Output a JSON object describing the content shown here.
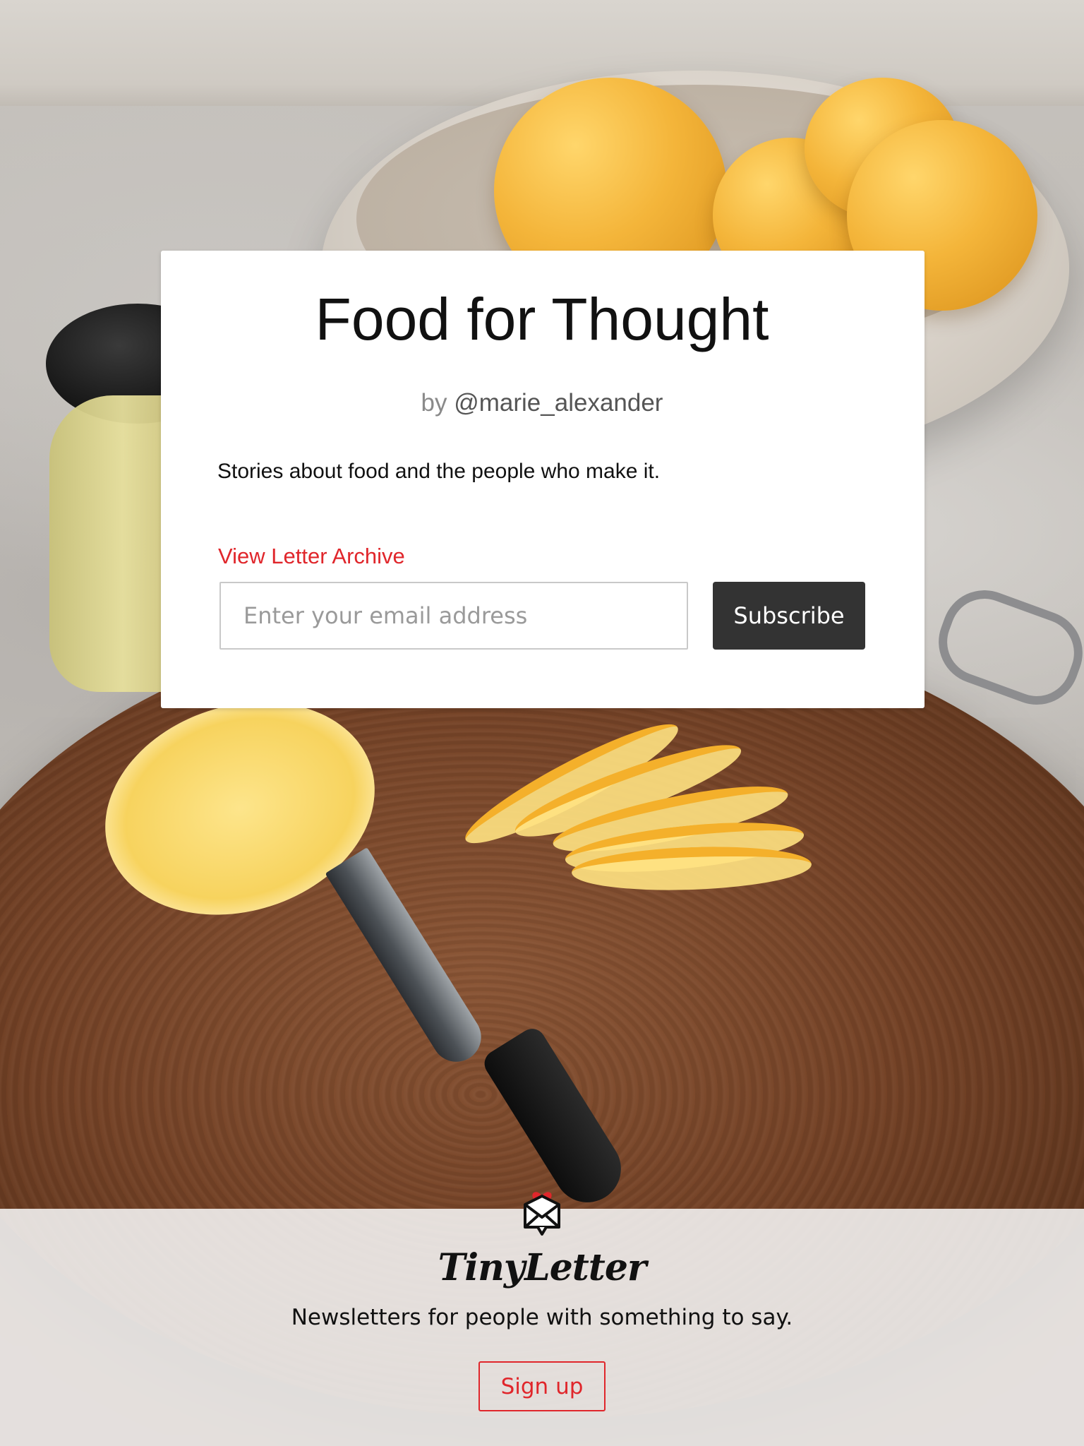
{
  "newsletter": {
    "title": "Food for Thought",
    "byline_prefix": "by",
    "author_handle": "@marie_alexander",
    "description": "Stories about food and the people who make it.",
    "archive_link": "View Letter Archive",
    "email_placeholder": "Enter your email address",
    "subscribe_label": "Subscribe"
  },
  "footer": {
    "logo_icon": "envelope-heart-icon",
    "brand": "TinyLetter",
    "tagline": "Newsletters for people with something to say.",
    "signup_label": "Sign up"
  },
  "colors": {
    "accent": "#e0262b",
    "button_dark": "#333333",
    "text": "#111111"
  }
}
